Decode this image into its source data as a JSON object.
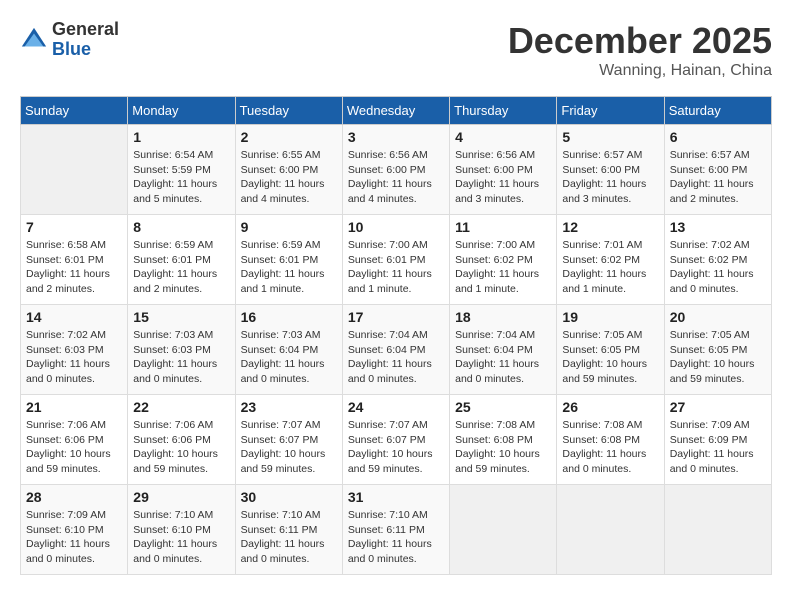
{
  "header": {
    "logo_general": "General",
    "logo_blue": "Blue",
    "month": "December 2025",
    "location": "Wanning, Hainan, China"
  },
  "columns": [
    "Sunday",
    "Monday",
    "Tuesday",
    "Wednesday",
    "Thursday",
    "Friday",
    "Saturday"
  ],
  "weeks": [
    [
      {
        "day": "",
        "info": ""
      },
      {
        "day": "1",
        "info": "Sunrise: 6:54 AM\nSunset: 5:59 PM\nDaylight: 11 hours\nand 5 minutes."
      },
      {
        "day": "2",
        "info": "Sunrise: 6:55 AM\nSunset: 6:00 PM\nDaylight: 11 hours\nand 4 minutes."
      },
      {
        "day": "3",
        "info": "Sunrise: 6:56 AM\nSunset: 6:00 PM\nDaylight: 11 hours\nand 4 minutes."
      },
      {
        "day": "4",
        "info": "Sunrise: 6:56 AM\nSunset: 6:00 PM\nDaylight: 11 hours\nand 3 minutes."
      },
      {
        "day": "5",
        "info": "Sunrise: 6:57 AM\nSunset: 6:00 PM\nDaylight: 11 hours\nand 3 minutes."
      },
      {
        "day": "6",
        "info": "Sunrise: 6:57 AM\nSunset: 6:00 PM\nDaylight: 11 hours\nand 2 minutes."
      }
    ],
    [
      {
        "day": "7",
        "info": "Sunrise: 6:58 AM\nSunset: 6:01 PM\nDaylight: 11 hours\nand 2 minutes."
      },
      {
        "day": "8",
        "info": "Sunrise: 6:59 AM\nSunset: 6:01 PM\nDaylight: 11 hours\nand 2 minutes."
      },
      {
        "day": "9",
        "info": "Sunrise: 6:59 AM\nSunset: 6:01 PM\nDaylight: 11 hours\nand 1 minute."
      },
      {
        "day": "10",
        "info": "Sunrise: 7:00 AM\nSunset: 6:01 PM\nDaylight: 11 hours\nand 1 minute."
      },
      {
        "day": "11",
        "info": "Sunrise: 7:00 AM\nSunset: 6:02 PM\nDaylight: 11 hours\nand 1 minute."
      },
      {
        "day": "12",
        "info": "Sunrise: 7:01 AM\nSunset: 6:02 PM\nDaylight: 11 hours\nand 1 minute."
      },
      {
        "day": "13",
        "info": "Sunrise: 7:02 AM\nSunset: 6:02 PM\nDaylight: 11 hours\nand 0 minutes."
      }
    ],
    [
      {
        "day": "14",
        "info": "Sunrise: 7:02 AM\nSunset: 6:03 PM\nDaylight: 11 hours\nand 0 minutes."
      },
      {
        "day": "15",
        "info": "Sunrise: 7:03 AM\nSunset: 6:03 PM\nDaylight: 11 hours\nand 0 minutes."
      },
      {
        "day": "16",
        "info": "Sunrise: 7:03 AM\nSunset: 6:04 PM\nDaylight: 11 hours\nand 0 minutes."
      },
      {
        "day": "17",
        "info": "Sunrise: 7:04 AM\nSunset: 6:04 PM\nDaylight: 11 hours\nand 0 minutes."
      },
      {
        "day": "18",
        "info": "Sunrise: 7:04 AM\nSunset: 6:04 PM\nDaylight: 11 hours\nand 0 minutes."
      },
      {
        "day": "19",
        "info": "Sunrise: 7:05 AM\nSunset: 6:05 PM\nDaylight: 10 hours\nand 59 minutes."
      },
      {
        "day": "20",
        "info": "Sunrise: 7:05 AM\nSunset: 6:05 PM\nDaylight: 10 hours\nand 59 minutes."
      }
    ],
    [
      {
        "day": "21",
        "info": "Sunrise: 7:06 AM\nSunset: 6:06 PM\nDaylight: 10 hours\nand 59 minutes."
      },
      {
        "day": "22",
        "info": "Sunrise: 7:06 AM\nSunset: 6:06 PM\nDaylight: 10 hours\nand 59 minutes."
      },
      {
        "day": "23",
        "info": "Sunrise: 7:07 AM\nSunset: 6:07 PM\nDaylight: 10 hours\nand 59 minutes."
      },
      {
        "day": "24",
        "info": "Sunrise: 7:07 AM\nSunset: 6:07 PM\nDaylight: 10 hours\nand 59 minutes."
      },
      {
        "day": "25",
        "info": "Sunrise: 7:08 AM\nSunset: 6:08 PM\nDaylight: 10 hours\nand 59 minutes."
      },
      {
        "day": "26",
        "info": "Sunrise: 7:08 AM\nSunset: 6:08 PM\nDaylight: 11 hours\nand 0 minutes."
      },
      {
        "day": "27",
        "info": "Sunrise: 7:09 AM\nSunset: 6:09 PM\nDaylight: 11 hours\nand 0 minutes."
      }
    ],
    [
      {
        "day": "28",
        "info": "Sunrise: 7:09 AM\nSunset: 6:10 PM\nDaylight: 11 hours\nand 0 minutes."
      },
      {
        "day": "29",
        "info": "Sunrise: 7:10 AM\nSunset: 6:10 PM\nDaylight: 11 hours\nand 0 minutes."
      },
      {
        "day": "30",
        "info": "Sunrise: 7:10 AM\nSunset: 6:11 PM\nDaylight: 11 hours\nand 0 minutes."
      },
      {
        "day": "31",
        "info": "Sunrise: 7:10 AM\nSunset: 6:11 PM\nDaylight: 11 hours\nand 0 minutes."
      },
      {
        "day": "",
        "info": ""
      },
      {
        "day": "",
        "info": ""
      },
      {
        "day": "",
        "info": ""
      }
    ]
  ]
}
